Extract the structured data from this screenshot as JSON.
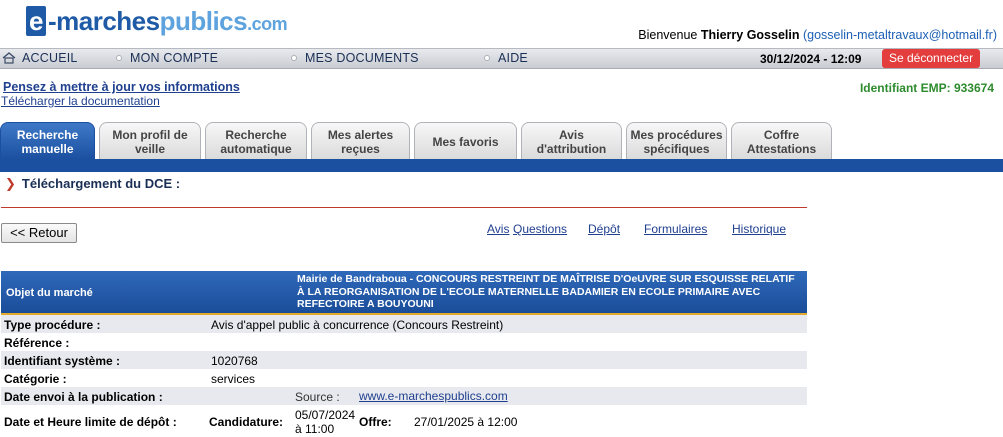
{
  "header": {
    "logo": {
      "e": "e",
      "marches": "-marches",
      "publics": "publics",
      "com": ".com"
    },
    "welcome_prefix": "Bienvenue",
    "user_name": "Thierry Gosselin",
    "user_email": "(gosselin-metaltravaux@hotmail.fr)"
  },
  "topnav": {
    "accueil": "ACCUEIL",
    "mon_compte": "MON COMPTE",
    "mes_documents": "MES DOCUMENTS",
    "aide": "AIDE",
    "datetime": "30/12/2024 - 12:09",
    "logout": "Se déconnecter"
  },
  "info": {
    "update_link": "Pensez à mettre à jour vos informations",
    "doc_link": "Télécharger la documentation",
    "identifiant": "Identifiant EMP: 933674"
  },
  "tabs": [
    {
      "line1": "Recherche",
      "line2": "manuelle"
    },
    {
      "line1": "Mon profil de",
      "line2": "veille"
    },
    {
      "line1": "Recherche",
      "line2": "automatique"
    },
    {
      "line1": "Mes alertes",
      "line2": "reçues"
    },
    {
      "line1": "Mes favoris",
      "line2": ""
    },
    {
      "line1": "Avis",
      "line2": "d'attribution"
    },
    {
      "line1": "Mes procédures",
      "line2": "spécifiques"
    },
    {
      "line1": "Coffre",
      "line2": "Attestations"
    }
  ],
  "page_title": "Téléchargement du DCE :",
  "back_button": "<< Retour",
  "sublinks": {
    "avis": "Avis",
    "questions": "Questions",
    "depot": "Dépôt",
    "formulaires": "Formulaires",
    "historique": "Historique"
  },
  "objet": {
    "label": "Objet du marché",
    "value": "Mairie de Bandraboua - CONCOURS RESTREINT DE MAÎTRISE D'OeUVRE SUR ESQUISSE RELATIF À LA REORGANISATION DE L'ECOLE MATERNELLE BADAMIER EN ECOLE PRIMAIRE AVEC REFECTOIRE A BOUYOUNI"
  },
  "details": [
    {
      "label": "Type procédure :",
      "value": "Avis d'appel public à concurrence (Concours Restreint)"
    },
    {
      "label": "Référence :",
      "value": ""
    },
    {
      "label": "Identifiant système :",
      "value": "1020768"
    },
    {
      "label": "Catégorie :",
      "value": "services"
    }
  ],
  "publication": {
    "label": "Date envoi à la publication :",
    "source_label": "Source :",
    "source_link": "www.e-marchespublics.com"
  },
  "deadline": {
    "label": "Date et Heure limite de dépôt :",
    "candidature_label": "Candidature:",
    "candidature_value": "05/07/2024 à 11:00",
    "offre_label": "Offre:",
    "offre_value": "27/01/2025 à 12:00"
  },
  "colors": {
    "brand_blue": "#1f5aa6",
    "light_blue": "#5ea3dd",
    "tab_active": "#1b4fa0",
    "logout_red": "#e33d3d",
    "ident_green": "#2e8b2e",
    "row_shade": "#e7e9ee"
  }
}
